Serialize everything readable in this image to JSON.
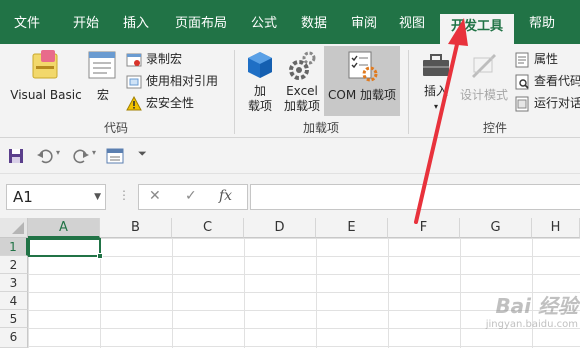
{
  "tabs": [
    {
      "label": "文件"
    },
    {
      "label": "开始"
    },
    {
      "label": "插入"
    },
    {
      "label": "页面布局"
    },
    {
      "label": "公式"
    },
    {
      "label": "数据"
    },
    {
      "label": "审阅"
    },
    {
      "label": "视图"
    },
    {
      "label": "开发工具",
      "active": true
    },
    {
      "label": "帮助"
    }
  ],
  "ribbon": {
    "code_group": {
      "label": "代码",
      "visual_basic": "Visual Basic",
      "macros": "宏",
      "record_macro": "录制宏",
      "relative_ref": "使用相对引用",
      "macro_security": "宏安全性"
    },
    "addins_group": {
      "label": "加载项",
      "addins_line1": "加",
      "addins_line2": "载项",
      "excel_addins_line1": "Excel",
      "excel_addins_line2": "加载项",
      "com_addins": "COM 加载项"
    },
    "controls_group": {
      "label": "控件",
      "insert": "插入",
      "design_mode": "设计模式",
      "properties": "属性",
      "view_code": "查看代码",
      "run_dialog": "运行对话"
    }
  },
  "formula_bar": {
    "name_box": "A1",
    "fx": "fx"
  },
  "grid": {
    "columns": [
      "A",
      "B",
      "C",
      "D",
      "E",
      "F",
      "G",
      "H"
    ],
    "rows": [
      "1",
      "2",
      "3",
      "4",
      "5",
      "6"
    ]
  },
  "watermark": {
    "line1": "Bai 经验",
    "line2": "jingyan.baidu.com"
  },
  "colors": {
    "accent": "#217346",
    "arrow": "#e8323c"
  }
}
